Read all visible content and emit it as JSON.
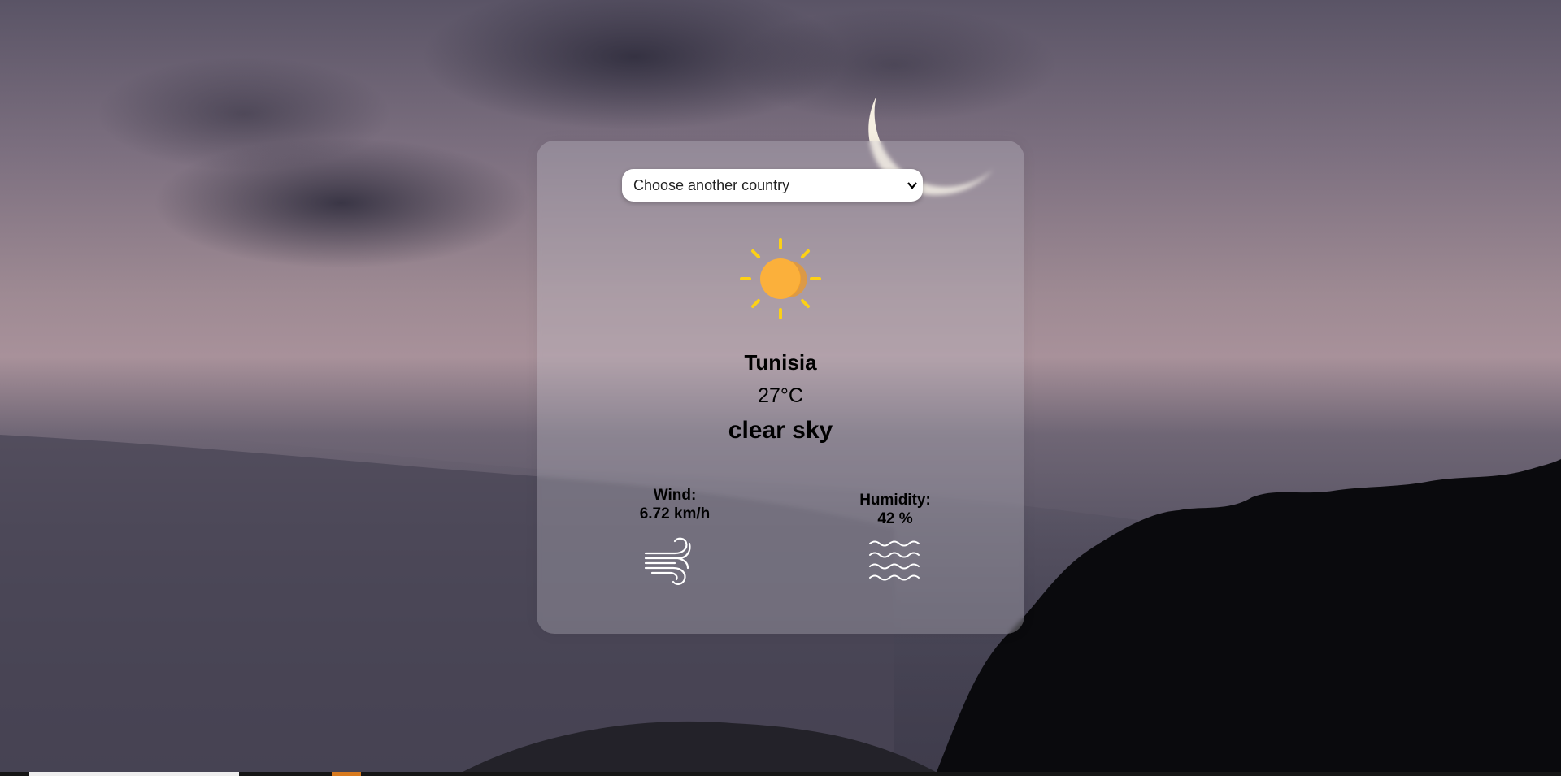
{
  "country_select": {
    "selected": "Choose another country"
  },
  "weather": {
    "icon": "sun-icon",
    "city": "Tunisia",
    "temperature": "27°C",
    "description": "clear sky"
  },
  "wind": {
    "label": "Wind:",
    "value": "6.72 km/h",
    "icon": "wind-icon"
  },
  "humidity": {
    "label": "Humidity:",
    "value": "42 %",
    "icon": "humidity-waves-icon"
  },
  "colors": {
    "sun_body": "#fbb03b",
    "sun_rays": "#fcd116",
    "card_tint": "rgba(200,195,205,0.32)",
    "select_bg": "#ffffff"
  }
}
